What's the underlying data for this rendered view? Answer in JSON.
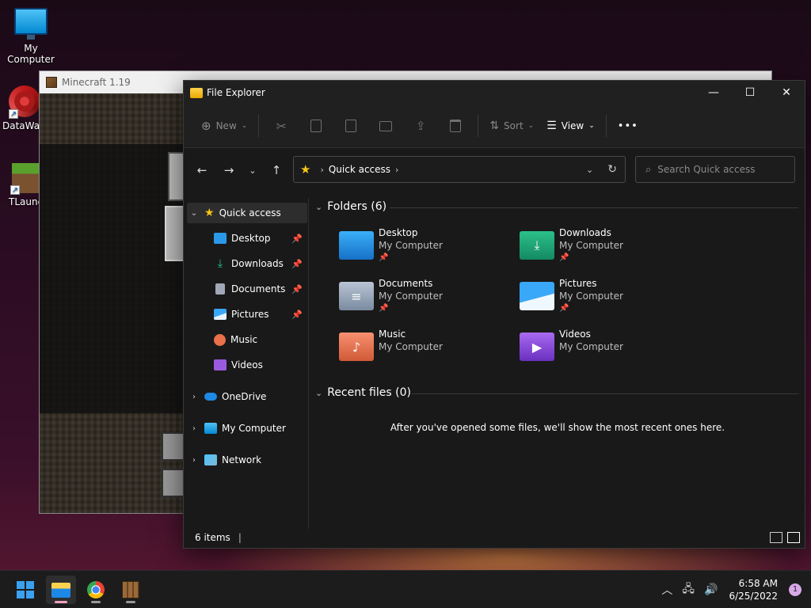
{
  "desktop": {
    "icons": [
      {
        "label": "My Computer"
      },
      {
        "label": "DataWag"
      },
      {
        "label": "TLaunc"
      }
    ]
  },
  "minecraft": {
    "title": "Minecraft 1.19"
  },
  "explorer": {
    "title": "File Explorer",
    "toolbar": {
      "new_label": "New",
      "sort_label": "Sort",
      "view_label": "View",
      "more_label": "•••"
    },
    "address": {
      "location": "Quick access"
    },
    "search": {
      "placeholder": "Search Quick access"
    },
    "sidebar": {
      "items": [
        {
          "label": "Quick access",
          "icon": "star-icon"
        },
        {
          "label": "Desktop",
          "icon": "desktop-folder-icon",
          "pinned": true
        },
        {
          "label": "Downloads",
          "icon": "download-icon",
          "pinned": true
        },
        {
          "label": "Documents",
          "icon": "document-icon",
          "pinned": true
        },
        {
          "label": "Pictures",
          "icon": "pictures-icon",
          "pinned": true
        },
        {
          "label": "Music",
          "icon": "music-icon"
        },
        {
          "label": "Videos",
          "icon": "videos-icon"
        },
        {
          "label": "OneDrive",
          "icon": "cloud-icon"
        },
        {
          "label": "My Computer",
          "icon": "computer-icon"
        },
        {
          "label": "Network",
          "icon": "network-icon"
        }
      ]
    },
    "folders": {
      "heading": "Folders (6)",
      "items": [
        {
          "name": "Desktop",
          "location": "My Computer",
          "pinned": true,
          "color": "#1e90e0"
        },
        {
          "name": "Downloads",
          "location": "My Computer",
          "pinned": true,
          "color": "#1fa37a"
        },
        {
          "name": "Documents",
          "location": "My Computer",
          "pinned": true,
          "color": "#8a9bb0"
        },
        {
          "name": "Pictures",
          "location": "My Computer",
          "pinned": true,
          "color": "#2a8ee8"
        },
        {
          "name": "Music",
          "location": "My Computer",
          "pinned": false,
          "color": "#e8704a"
        },
        {
          "name": "Videos",
          "location": "My Computer",
          "pinned": false,
          "color": "#8a4ad8"
        }
      ]
    },
    "recent": {
      "heading": "Recent files (0)",
      "empty_message": "After you've opened some files, we'll show the most recent ones here."
    },
    "status": {
      "count": "6 items"
    }
  },
  "taskbar": {
    "time": "6:58 AM",
    "date": "6/25/2022",
    "notification_count": "1"
  }
}
